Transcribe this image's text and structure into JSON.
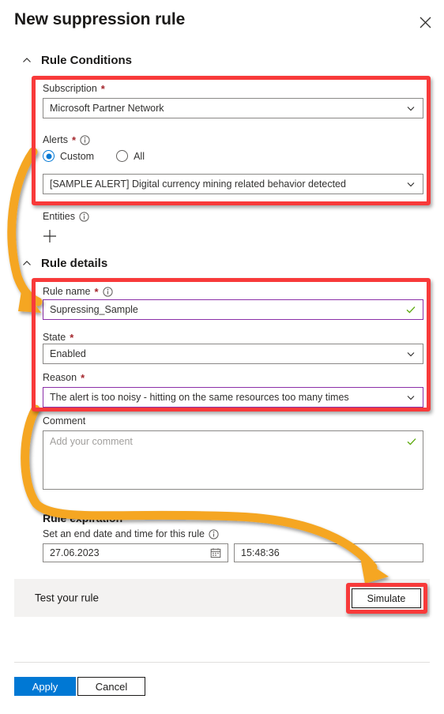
{
  "header": {
    "title": "New suppression rule",
    "close_icon": "close-icon"
  },
  "sections": {
    "rule_conditions": {
      "label": "Rule Conditions",
      "collapse_icon": "chevron-up-icon"
    },
    "rule_details": {
      "label": "Rule details",
      "collapse_icon": "chevron-up-icon"
    }
  },
  "rule_conditions": {
    "subscription": {
      "label": "Subscription",
      "required": "*",
      "value": "Microsoft Partner Network",
      "caret_icon": "chevron-down-icon"
    },
    "alerts": {
      "label": "Alerts",
      "required": "*",
      "info_icon": "info-icon",
      "options": [
        {
          "label": "Custom",
          "selected": true
        },
        {
          "label": "All",
          "selected": false
        }
      ],
      "selected_alert": "[SAMPLE ALERT] Digital currency mining related behavior detected",
      "caret_icon": "chevron-down-icon"
    },
    "entities": {
      "label": "Entities",
      "info_icon": "info-icon",
      "add_icon": "plus-icon"
    }
  },
  "rule_details": {
    "rule_name": {
      "label": "Rule name",
      "required": "*",
      "info_icon": "info-icon",
      "value": "Supressing_Sample",
      "valid_icon": "checkmark-icon"
    },
    "state": {
      "label": "State",
      "required": "*",
      "value": "Enabled",
      "caret_icon": "chevron-down-icon"
    },
    "reason": {
      "label": "Reason",
      "required": "*",
      "value": "The alert is too noisy - hitting on the same resources too many times",
      "caret_icon": "chevron-down-icon"
    },
    "comment": {
      "label": "Comment",
      "placeholder": "Add your comment",
      "value": "",
      "valid_icon": "checkmark-icon"
    }
  },
  "rule_expiration": {
    "title": "Rule expiration",
    "subtitle": "Set an end date and time for this rule",
    "info_icon": "info-icon",
    "date": {
      "value": "27.06.2023",
      "icon": "calendar-icon"
    },
    "time": {
      "value": "15:48:36"
    }
  },
  "test_rule": {
    "label": "Test your rule",
    "simulate_label": "Simulate"
  },
  "footer": {
    "apply_label": "Apply",
    "cancel_label": "Cancel"
  },
  "annotations": {
    "highlight_color": "#f83a3a",
    "arrow_color": "#f5a623",
    "arrows": [
      {
        "name": "arrow-alerts-to-rule-name"
      },
      {
        "name": "arrow-reason-to-simulate"
      }
    ],
    "highlight_boxes": [
      {
        "name": "highlight-rule-conditions-fields"
      },
      {
        "name": "highlight-rule-details-fields"
      },
      {
        "name": "highlight-simulate-button"
      }
    ]
  }
}
